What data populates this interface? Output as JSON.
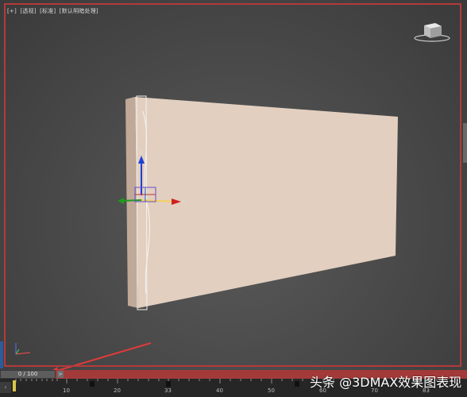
{
  "viewport": {
    "label_parts": [
      "[+]",
      "[透视]",
      "[标准]",
      "[默认明暗处理]"
    ]
  },
  "time_slider": {
    "frame_display": "0 / 100",
    "next_label": ">"
  },
  "trackbar": {
    "left_label": "‹",
    "ticks": [
      "10",
      "20",
      "33",
      "40",
      "50",
      "60",
      "70",
      "83"
    ]
  },
  "watermark": "头条 @3DMAX效果图表现",
  "colors": {
    "wall_front": "#e2cfc0",
    "wall_side": "#bfa898",
    "viewport_border": "#b33a3a",
    "time_slider": "#a33a3a"
  }
}
